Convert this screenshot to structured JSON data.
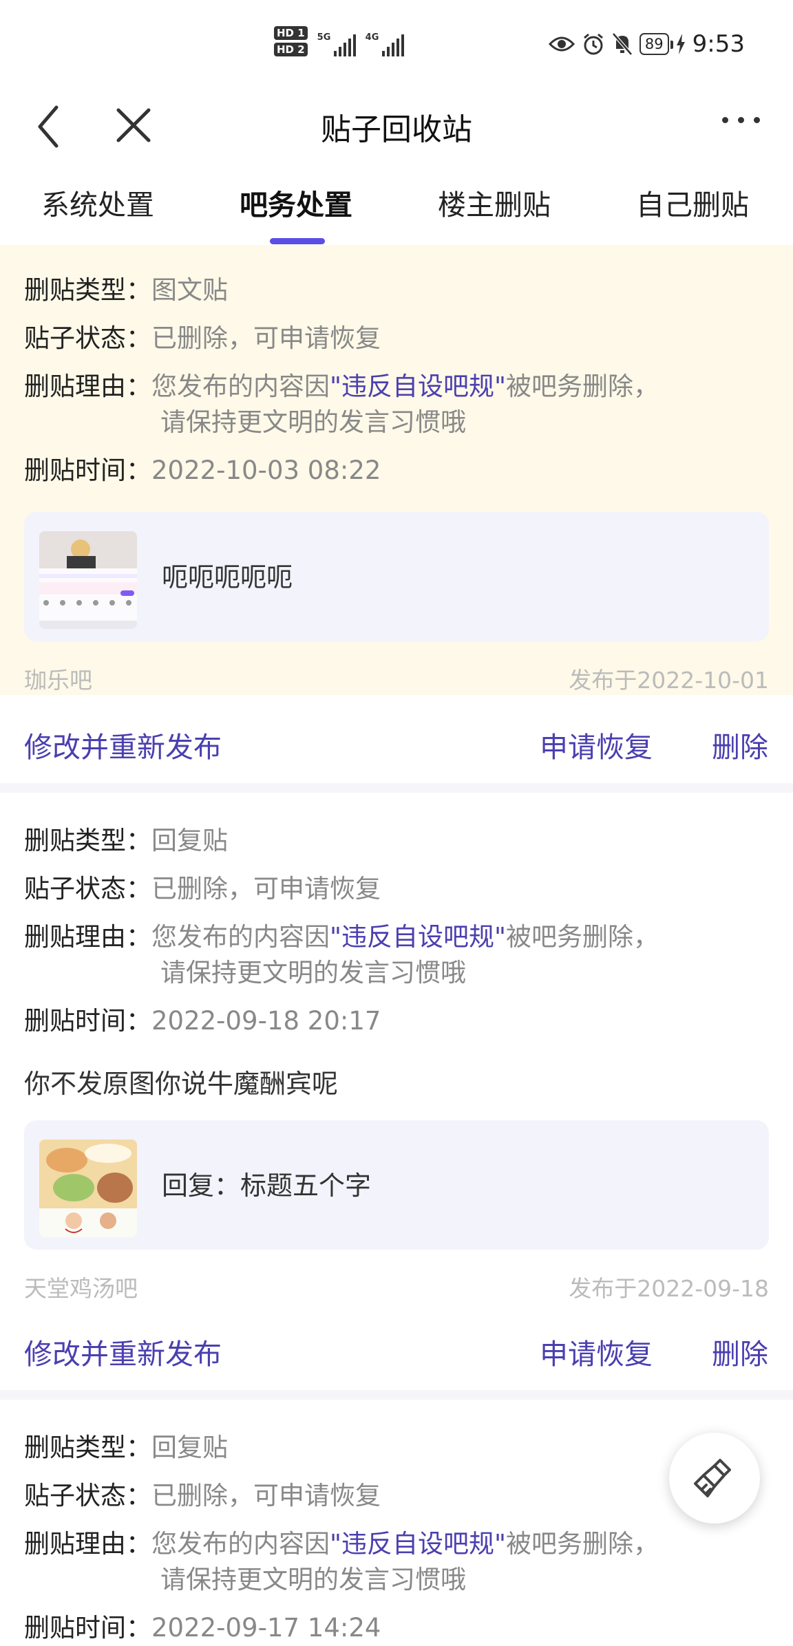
{
  "status_bar": {
    "hd1": "HD 1",
    "hd2": "HD 2",
    "net1": "5G",
    "net2": "4G",
    "battery": "89",
    "time": "9:53"
  },
  "nav": {
    "title": "贴子回收站"
  },
  "tabs": [
    {
      "label": "系统处置"
    },
    {
      "label": "吧务处置"
    },
    {
      "label": "楼主删贴"
    },
    {
      "label": "自己删贴"
    }
  ],
  "active_tab": 1,
  "labels": {
    "type": "删贴类型：",
    "status": "贴子状态：",
    "reason": "删贴理由：",
    "time": "删贴时间："
  },
  "actions": {
    "edit": "修改并重新发布",
    "restore": "申请恢复",
    "delete": "删除"
  },
  "colors": {
    "accent": "#5b4ee6",
    "highlight_bg": "#fef9e8",
    "thread_bg": "#f3f3fc"
  },
  "posts": [
    {
      "type": "图文贴",
      "status": "已删除，可申请恢复",
      "reason_prefix": "您发布的内容因",
      "reason_keyword": "\"违反自设吧规\"",
      "reason_suffix": "被吧务删除，",
      "reason_line2": "请保持更文明的发言习惯哦",
      "time": "2022-10-03 08:22",
      "thread_title": "呃呃呃呃呃",
      "forum": "珈乐吧",
      "published": "发布于2022-10-01"
    },
    {
      "type": "回复贴",
      "status": "已删除，可申请恢复",
      "reason_prefix": "您发布的内容因",
      "reason_keyword": "\"违反自设吧规\"",
      "reason_suffix": "被吧务删除，",
      "reason_line2": "请保持更文明的发言习惯哦",
      "time": "2022-09-18 20:17",
      "content": "你不发原图你说牛魔酬宾呢",
      "thread_title": "回复：标题五个字",
      "forum": "天堂鸡汤吧",
      "published": "发布于2022-09-18"
    },
    {
      "type": "回复贴",
      "status": "已删除，可申请恢复",
      "reason_prefix": "您发布的内容因",
      "reason_keyword": "\"违反自设吧规\"",
      "reason_suffix": "被吧务删除，",
      "reason_line2": "请保持更文明的发言习惯哦",
      "time": "2022-09-17 14:24"
    }
  ]
}
